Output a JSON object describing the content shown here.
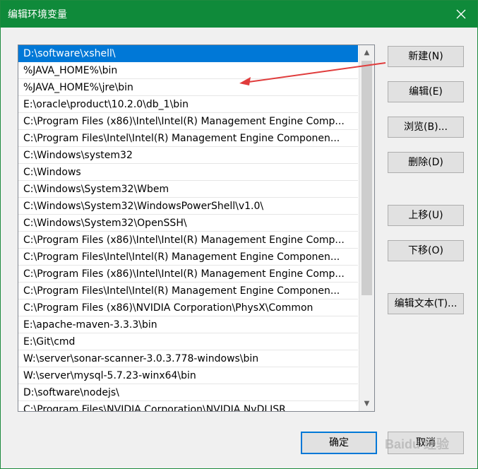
{
  "window": {
    "title": "编辑环境变量"
  },
  "list": {
    "items": [
      "D:\\software\\xshell\\",
      "%JAVA_HOME%\\bin",
      "%JAVA_HOME%\\jre\\bin",
      "E:\\oracle\\product\\10.2.0\\db_1\\bin",
      "C:\\Program Files (x86)\\Intel\\Intel(R) Management Engine Comp...",
      "C:\\Program Files\\Intel\\Intel(R) Management Engine Componen...",
      "C:\\Windows\\system32",
      "C:\\Windows",
      "C:\\Windows\\System32\\Wbem",
      "C:\\Windows\\System32\\WindowsPowerShell\\v1.0\\",
      "C:\\Windows\\System32\\OpenSSH\\",
      "C:\\Program Files (x86)\\Intel\\Intel(R) Management Engine Comp...",
      "C:\\Program Files\\Intel\\Intel(R) Management Engine Componen...",
      "C:\\Program Files (x86)\\Intel\\Intel(R) Management Engine Comp...",
      "C:\\Program Files\\Intel\\Intel(R) Management Engine Componen...",
      "C:\\Program Files (x86)\\NVIDIA Corporation\\PhysX\\Common",
      "E:\\apache-maven-3.3.3\\bin",
      "E:\\Git\\cmd",
      "W:\\server\\sonar-scanner-3.0.3.778-windows\\bin",
      "W:\\server\\mysql-5.7.23-winx64\\bin",
      "D:\\software\\nodejs\\",
      "C:\\Program Files\\NVIDIA Corporation\\NVIDIA NvDLISR"
    ],
    "selected_index": 0
  },
  "buttons": {
    "new": "新建(N)",
    "edit": "编辑(E)",
    "browse": "浏览(B)...",
    "delete": "删除(D)",
    "move_up": "上移(U)",
    "move_down": "下移(O)",
    "edit_text": "编辑文本(T)...",
    "ok": "确定",
    "cancel": "取消"
  },
  "watermark": "Baidu 经验",
  "colors": {
    "titlebar": "#0f8a3a",
    "selection": "#0078d7",
    "annotation_arrow": "#e03c3c"
  }
}
